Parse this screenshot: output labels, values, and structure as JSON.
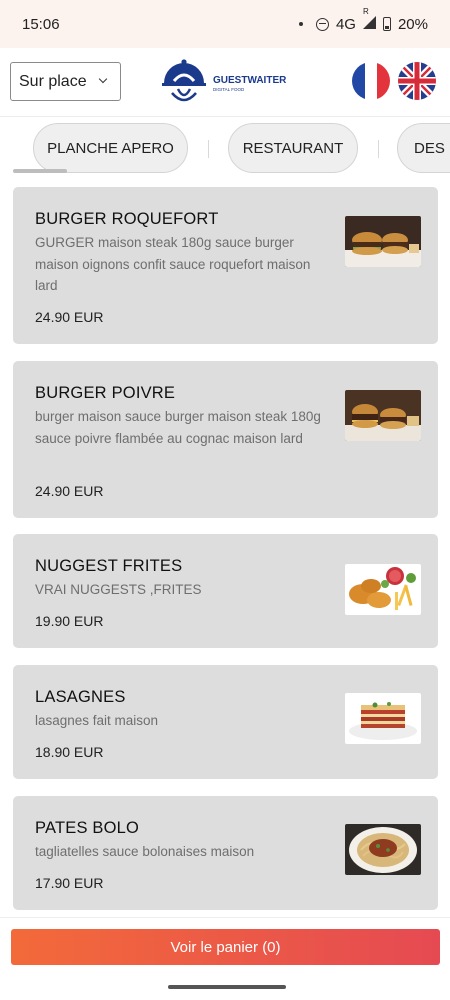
{
  "status": {
    "time": "15:06",
    "network": "4G",
    "roaming": "R",
    "battery": "20%"
  },
  "header": {
    "mode_select": {
      "value": "Sur place",
      "icon": "chevron-down-icon"
    },
    "logo": {
      "brand": "GUESTWAITER",
      "tagline": "DIGITAL FOOD"
    },
    "languages": [
      "fr-flag",
      "uk-flag"
    ]
  },
  "categories": [
    "PLANCHE APERO",
    "RESTAURANT",
    "DES"
  ],
  "items": [
    {
      "name": "BURGER ROQUEFORT",
      "description": "GURGER maison steak 180g sauce burger maison oignons confit sauce roquefort maison lard",
      "price": "24.90 EUR",
      "image": "burger"
    },
    {
      "name": "BURGER POIVRE",
      "description": "burger maison sauce burger maison steak 180g sauce poivre flambée au cognac maison lard",
      "price": "24.90 EUR",
      "image": "burger"
    },
    {
      "name": "NUGGEST FRITES",
      "description": "VRAI NUGGESTS ,FRITES",
      "price": "19.90 EUR",
      "image": "nuggets"
    },
    {
      "name": "LASAGNES",
      "description": "lasagnes fait maison",
      "price": "18.90 EUR",
      "image": "lasagna"
    },
    {
      "name": "PATES BOLO",
      "description": "tagliatelles sauce bolonaises maison",
      "price": "17.90 EUR",
      "image": "pasta"
    }
  ],
  "cart_button": "Voir le panier (0)",
  "colors": {
    "accent_start": "#f36a3a",
    "accent_end": "#e54a52",
    "card_bg": "#dddddd",
    "brand_blue": "#1b3a8c"
  }
}
